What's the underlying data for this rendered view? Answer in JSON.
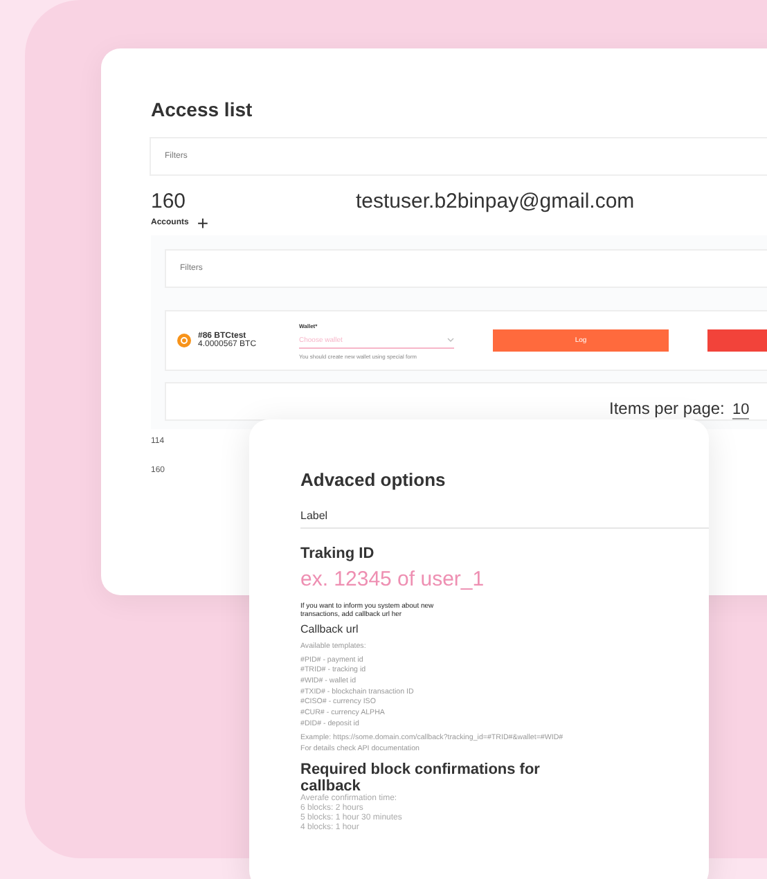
{
  "access_list": {
    "title": "Access list",
    "filters_label": "Filters",
    "count": "160",
    "email": "testuser.b2binpay@gmail.com",
    "accounts_label": "Accounts",
    "add_icon": "+",
    "inner_filters_label": "Filters",
    "account": {
      "name": "#86 BTCtest",
      "balance": "4.0000567 BTC",
      "wallet_label": "Wallet*",
      "wallet_placeholder": "Choose wallet",
      "wallet_hint": "You should create new wallet using special form",
      "log_button": "Log"
    },
    "items_per_page_label": "Items per page:",
    "items_per_page": "10",
    "rows": [
      "114",
      "160"
    ]
  },
  "advanced_options": {
    "title": "Advaced options",
    "label_field": "Label",
    "tracking_title": "Traking ID",
    "tracking_placeholder": "ex. 12345 of user_1",
    "callback_hint": "If you want to inform you system about new transactions, add callback url her",
    "callback_title": "Callback url",
    "templates_title": "Available templates:",
    "templates": [
      "#PID# - payment id",
      "#TRID# - tracking id",
      "#WID# - wallet id",
      "#TXID# - blockchain transaction ID",
      "#CISO# - currency ISO",
      "#CUR# - currency ALPHA",
      "#DID# - deposit id"
    ],
    "example": "Example: https://some.domain.com/callback?tracking_id=#TRID#&wallet=#WID#",
    "docs_note": "For details check API documentation",
    "confirmations_title": "Required block confirmations for callback",
    "avg_title": "Averafe confirmation time:",
    "avg_times": [
      "6 blocks: 2 hours",
      "5 blocks: 1 hour 30 minutes",
      "4 blocks: 1 hour"
    ]
  }
}
